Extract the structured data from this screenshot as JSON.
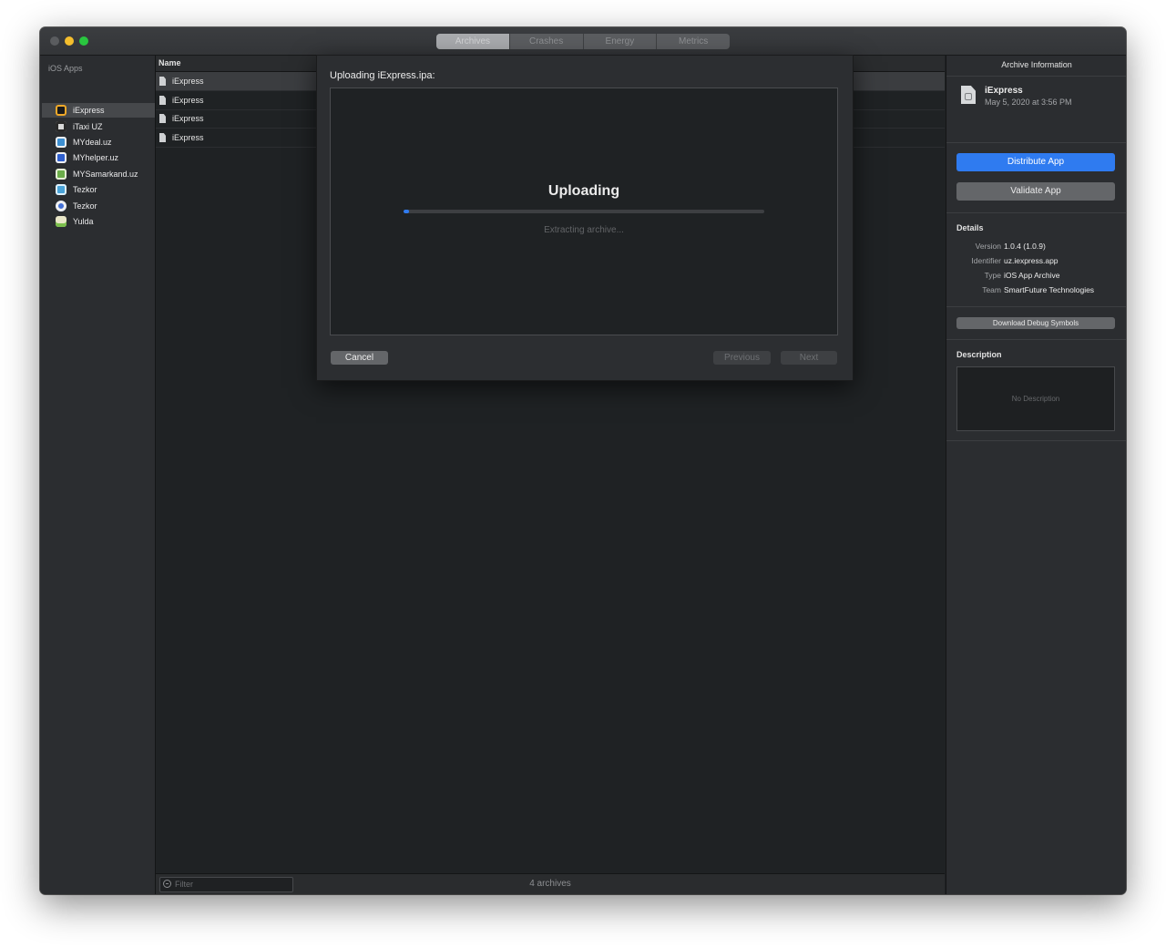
{
  "window": {
    "tabs": [
      {
        "label": "Archives",
        "active": true
      },
      {
        "label": "Crashes",
        "active": false
      },
      {
        "label": "Energy",
        "active": false
      },
      {
        "label": "Metrics",
        "active": false
      }
    ]
  },
  "sidebar": {
    "header": "iOS Apps",
    "items": [
      {
        "label": "iExpress",
        "selected": true,
        "icon": "iexpress-app-icon",
        "color": "#1b1b1b"
      },
      {
        "label": "iTaxi UZ",
        "selected": false,
        "icon": "itaxi-app-icon",
        "color": "#d8d8d8"
      },
      {
        "label": "MYdeal.uz",
        "selected": false,
        "icon": "mydeal-app-icon",
        "color": "#3d8fd1"
      },
      {
        "label": "MYhelper.uz",
        "selected": false,
        "icon": "myhelper-app-icon",
        "color": "#2f5fce"
      },
      {
        "label": "MYSamarkand.uz",
        "selected": false,
        "icon": "mysamarkand-app-icon",
        "color": "#6cae4a"
      },
      {
        "label": "Tezkor",
        "selected": false,
        "icon": "tezkor-app-icon",
        "color": "#4aa3d8"
      },
      {
        "label": "Tezkor",
        "selected": false,
        "icon": "tezkor-app-icon",
        "color": "#4470d6"
      },
      {
        "label": "Yulda",
        "selected": false,
        "icon": "yulda-app-icon",
        "color": "#e9e6c8"
      }
    ]
  },
  "archive_list": {
    "column_name": "Name",
    "rows": [
      {
        "name": "iExpress",
        "selected": true
      },
      {
        "name": "iExpress",
        "selected": false
      },
      {
        "name": "iExpress",
        "selected": false
      },
      {
        "name": "iExpress",
        "selected": false
      }
    ],
    "filter_placeholder": "Filter",
    "count_label": "4 archives"
  },
  "info_panel": {
    "title": "Archive Information",
    "archive_name": "iExpress",
    "archive_date": "May 5, 2020 at 3:56 PM",
    "distribute_label": "Distribute App",
    "validate_label": "Validate App",
    "details_title": "Details",
    "details": [
      {
        "key": "Version",
        "value": "1.0.4 (1.0.9)"
      },
      {
        "key": "Identifier",
        "value": "uz.iexpress.app"
      },
      {
        "key": "Type",
        "value": "iOS App Archive"
      },
      {
        "key": "Team",
        "value": "SmartFuture Technologies"
      }
    ],
    "debug_symbols_label": "Download Debug Symbols",
    "description_title": "Description",
    "description_placeholder": "No Description"
  },
  "upload_sheet": {
    "title": "Uploading iExpress.ipa:",
    "heading": "Uploading",
    "status": "Extracting archive...",
    "progress": 0.015,
    "cancel_label": "Cancel",
    "previous_label": "Previous",
    "next_label": "Next"
  },
  "colors": {
    "accent": "#2f7bf0",
    "close": "#5a5c5f",
    "minimize": "#f5be2d",
    "maximize": "#29c63f"
  }
}
